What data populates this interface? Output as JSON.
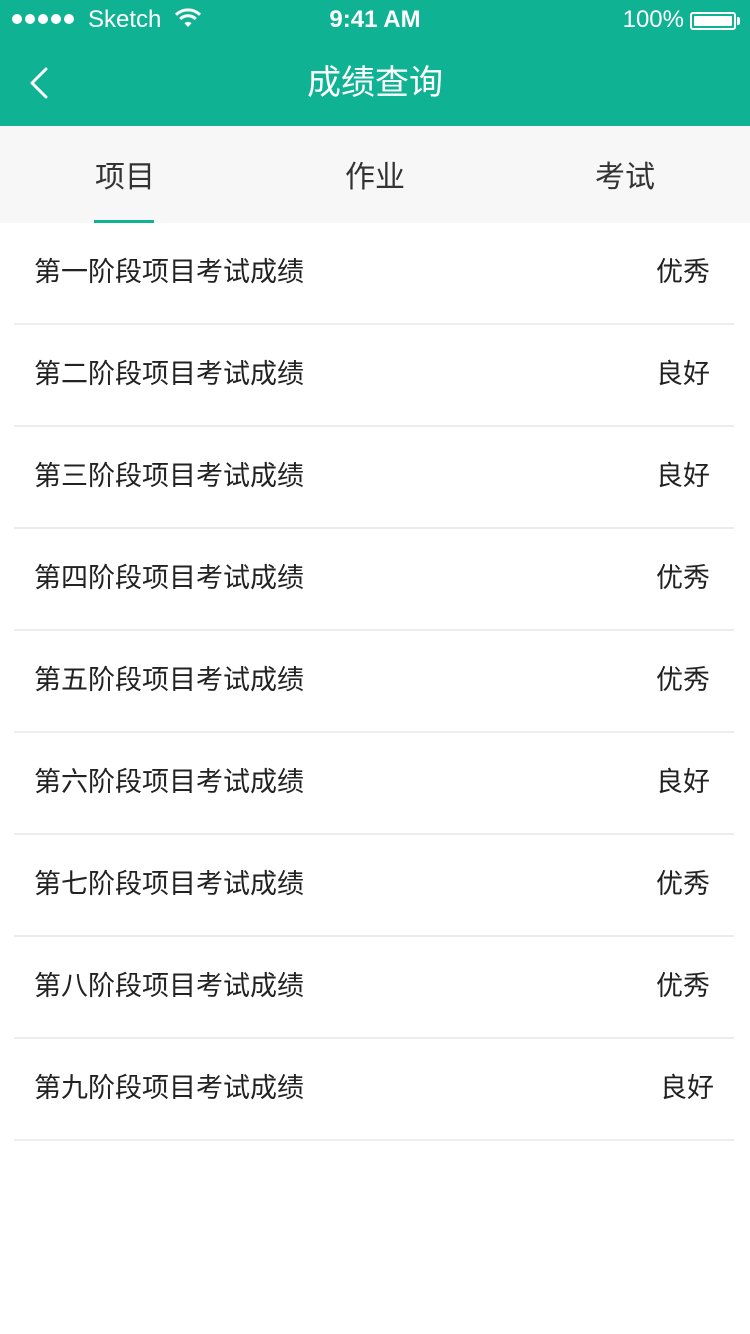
{
  "status_bar": {
    "carrier": "Sketch",
    "time": "9:41 AM",
    "battery": "100%",
    "battery_level": 1.0
  },
  "nav": {
    "title": "成绩查询",
    "back_icon": "chevron-left-icon"
  },
  "colors": {
    "accent": "#10b294",
    "tab_bar": "#f7f7f7",
    "divider": "#ececec",
    "text": "#222222"
  },
  "tabs": [
    {
      "label": "项目",
      "selected": true
    },
    {
      "label": "作业",
      "selected": false
    },
    {
      "label": "考试",
      "selected": false
    }
  ],
  "rows": [
    {
      "label": "第一阶段项目考试成绩",
      "grade": "优秀"
    },
    {
      "label": "第二阶段项目考试成绩",
      "grade": "良好"
    },
    {
      "label": "第三阶段项目考试成绩",
      "grade": "良好"
    },
    {
      "label": "第四阶段项目考试成绩",
      "grade": "优秀"
    },
    {
      "label": "第五阶段项目考试成绩",
      "grade": "优秀"
    },
    {
      "label": "第六阶段项目考试成绩",
      "grade": "良好"
    },
    {
      "label": "第七阶段项目考试成绩",
      "grade": "优秀"
    },
    {
      "label": "第八阶段项目考试成绩",
      "grade": "优秀"
    },
    {
      "label": "第九阶段项目考试成绩",
      "grade": "良好"
    }
  ]
}
